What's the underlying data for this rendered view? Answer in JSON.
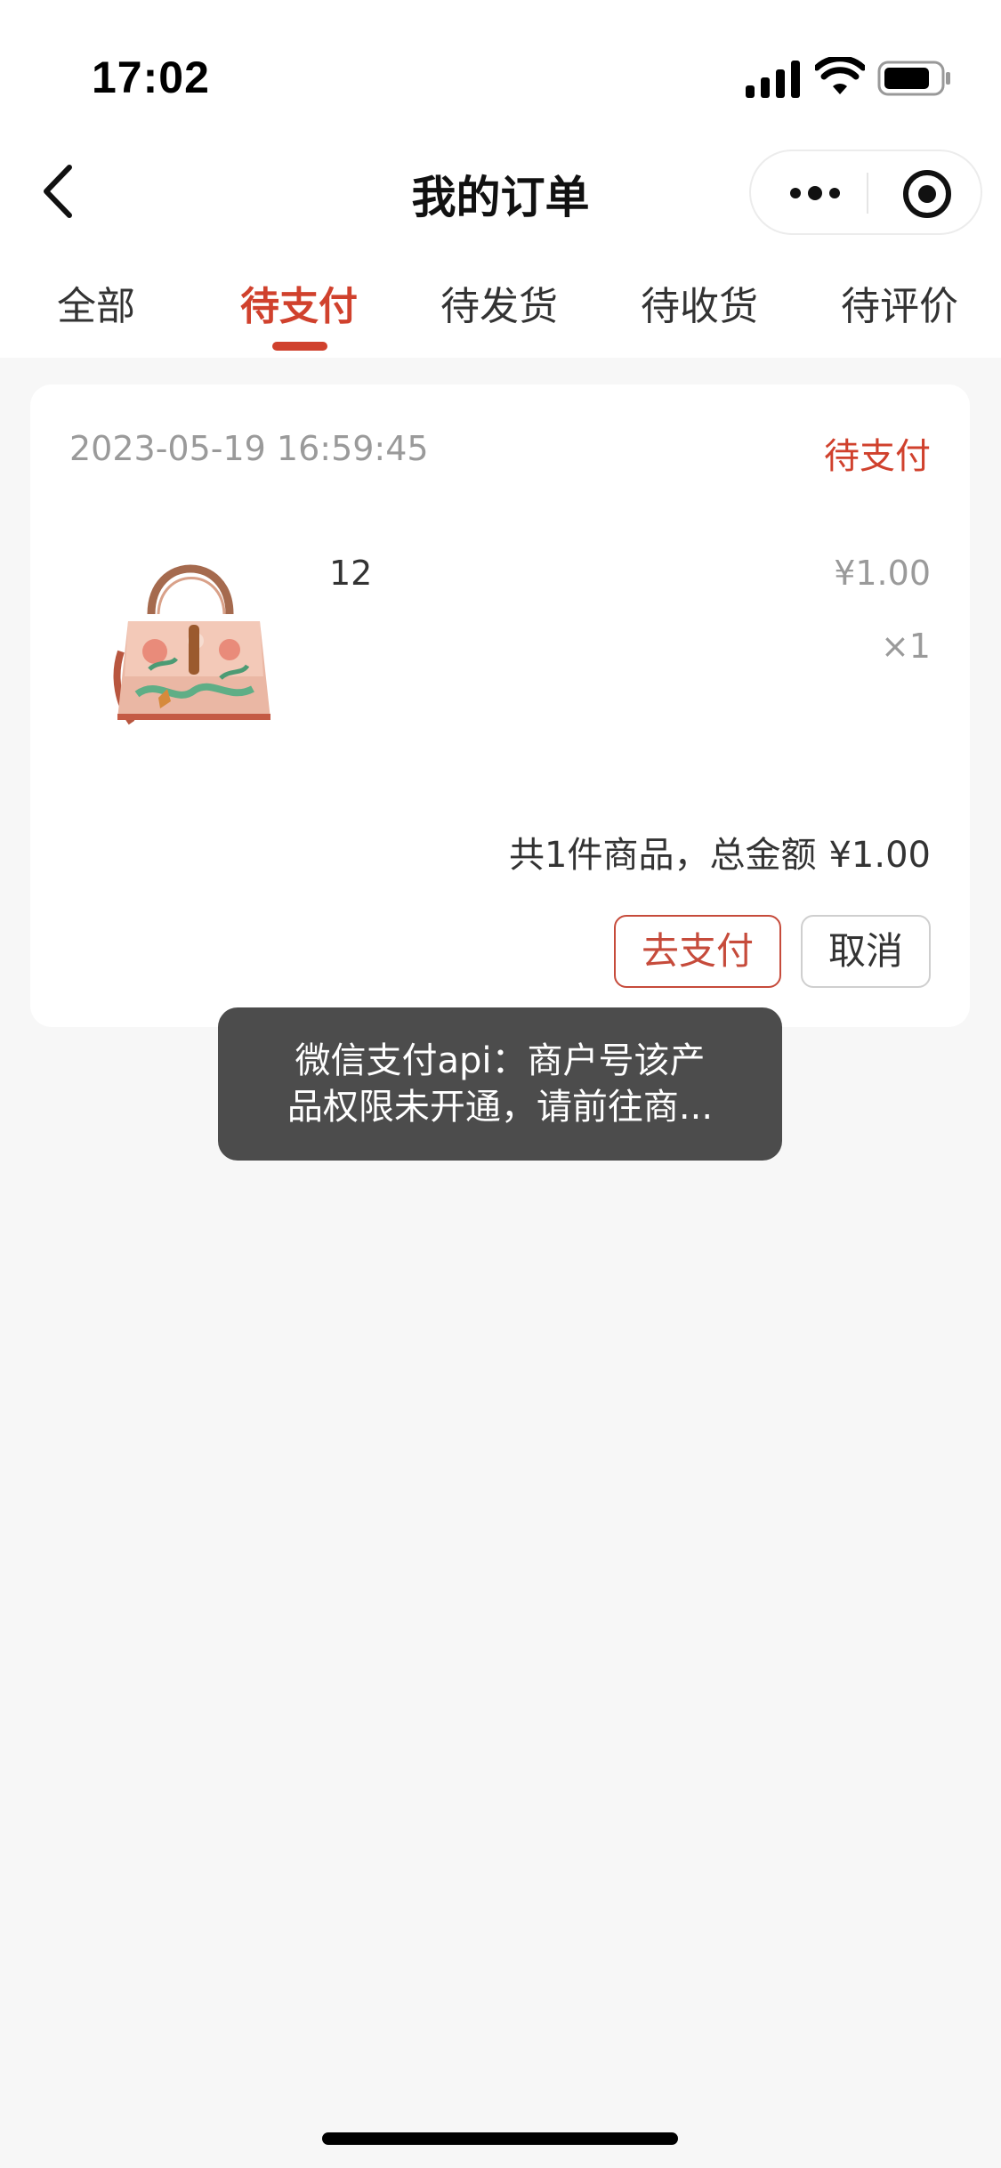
{
  "status_bar": {
    "time": "17:02"
  },
  "nav": {
    "title": "我的订单"
  },
  "tabs": [
    {
      "label": "全部",
      "active": false
    },
    {
      "label": "待支付",
      "active": true
    },
    {
      "label": "待发货",
      "active": false
    },
    {
      "label": "待收货",
      "active": false
    },
    {
      "label": "待评价",
      "active": false
    }
  ],
  "order": {
    "time": "2023-05-19 16:59:45",
    "status": "待支付",
    "product": {
      "name": "12",
      "price": "¥1.00",
      "quantity": "×1"
    },
    "summary": {
      "count_text": "共1件商品，总金额",
      "total": "¥1.00"
    },
    "buttons": {
      "pay": "去支付",
      "cancel": "取消"
    }
  },
  "toast": {
    "line1": "微信支付api：商户号该产",
    "line2": "品权限未开通，请前往商..."
  },
  "colors": {
    "accent": "#d0412d",
    "toast_bg": "#4c4c4c",
    "page_bg": "#f7f7f7"
  }
}
